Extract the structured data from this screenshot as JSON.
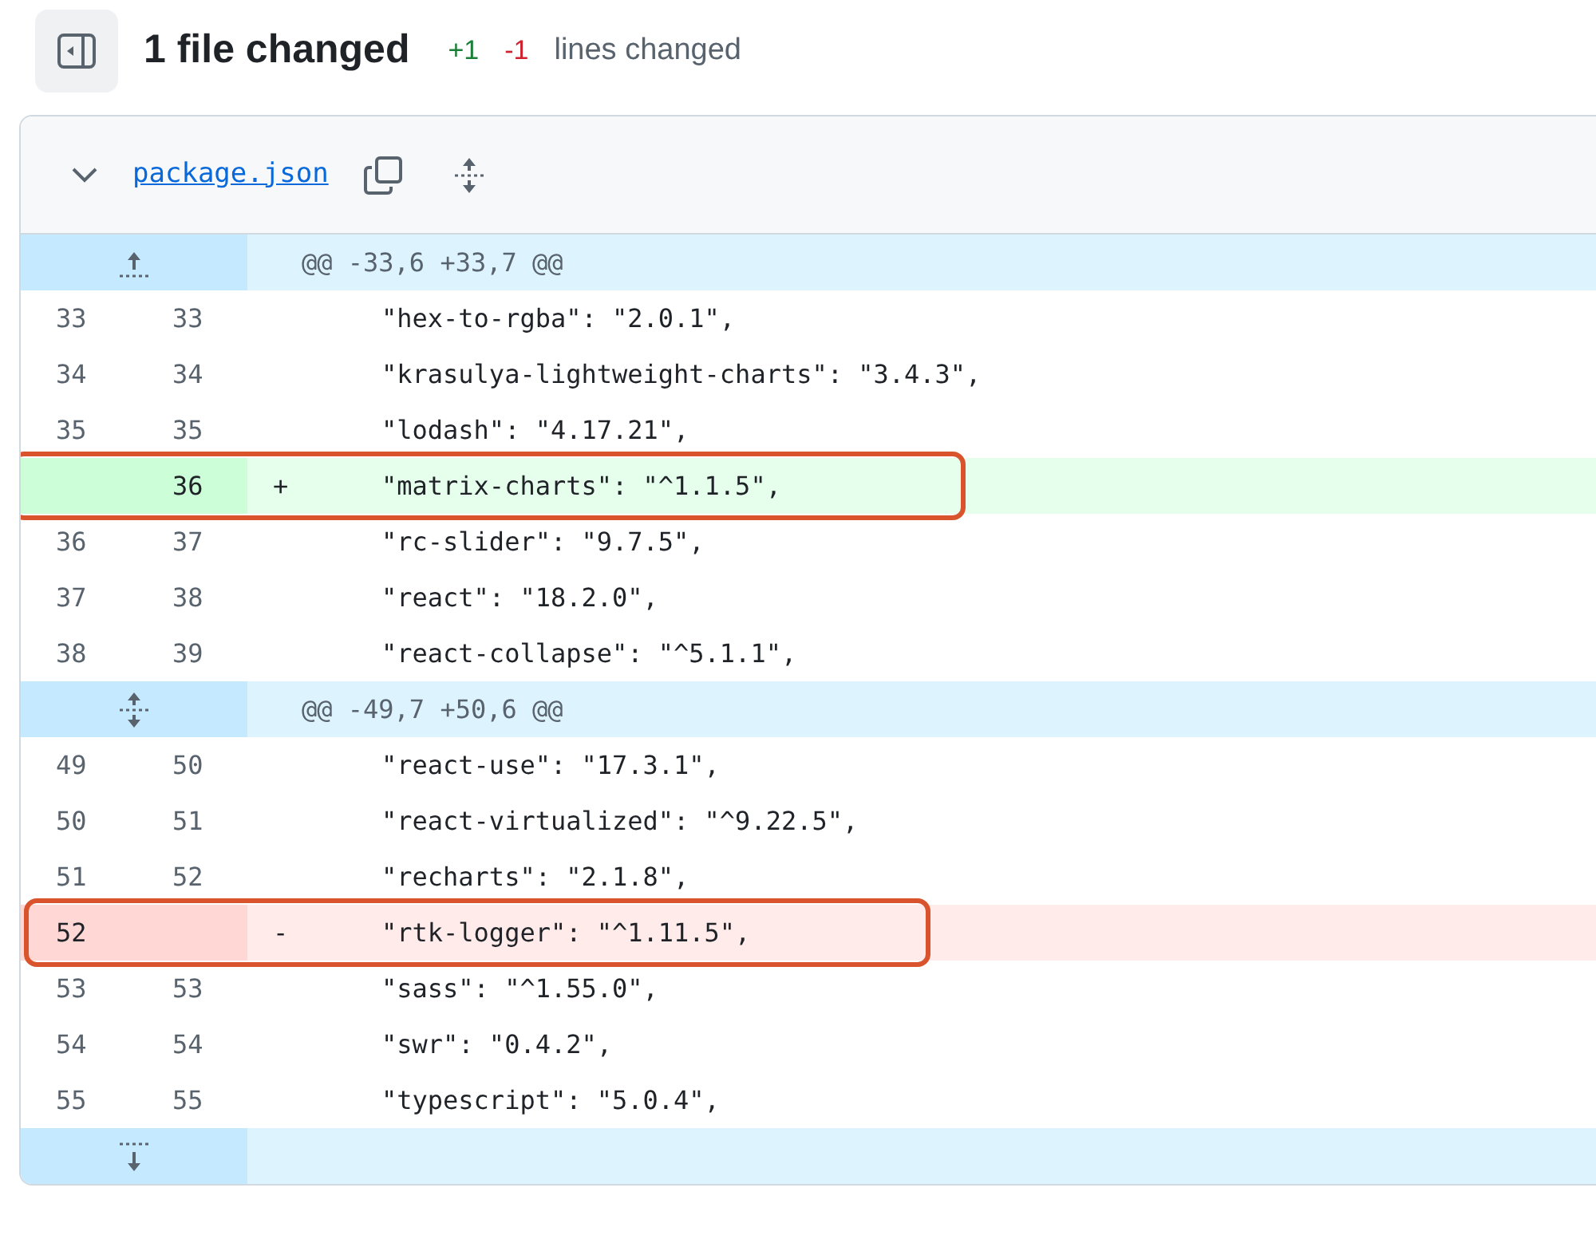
{
  "header": {
    "title": "1 file changed",
    "additions": "+1",
    "deletions": "-1",
    "summary": "lines changed"
  },
  "file": {
    "name": "package.json",
    "expanded": true
  },
  "diff": [
    {
      "kind": "hunk_up",
      "text": "@@ -33,6 +33,7 @@"
    },
    {
      "kind": "context",
      "old": "33",
      "new": "33",
      "code": "\"hex-to-rgba\": \"2.0.1\","
    },
    {
      "kind": "context",
      "old": "34",
      "new": "34",
      "code": "\"krasulya-lightweight-charts\": \"3.4.3\","
    },
    {
      "kind": "context",
      "old": "35",
      "new": "35",
      "code": "\"lodash\": \"4.17.21\","
    },
    {
      "kind": "add",
      "new": "36",
      "sign": "+",
      "code": "\"matrix-charts\": \"^1.1.5\",",
      "highlighted": true
    },
    {
      "kind": "context",
      "old": "36",
      "new": "37",
      "code": "\"rc-slider\": \"9.7.5\","
    },
    {
      "kind": "context",
      "old": "37",
      "new": "38",
      "code": "\"react\": \"18.2.0\","
    },
    {
      "kind": "context",
      "old": "38",
      "new": "39",
      "code": "\"react-collapse\": \"^5.1.1\","
    },
    {
      "kind": "hunk_both",
      "text": "@@ -49,7 +50,6 @@"
    },
    {
      "kind": "context",
      "old": "49",
      "new": "50",
      "code": "\"react-use\": \"17.3.1\","
    },
    {
      "kind": "context",
      "old": "50",
      "new": "51",
      "code": "\"react-virtualized\": \"^9.22.5\","
    },
    {
      "kind": "context",
      "old": "51",
      "new": "52",
      "code": "\"recharts\": \"2.1.8\","
    },
    {
      "kind": "del",
      "old": "52",
      "sign": "-",
      "code": "\"rtk-logger\": \"^1.11.5\",",
      "highlighted": true
    },
    {
      "kind": "context",
      "old": "53",
      "new": "53",
      "code": "\"sass\": \"^1.55.0\","
    },
    {
      "kind": "context",
      "old": "54",
      "new": "54",
      "code": "\"swr\": \"0.4.2\","
    },
    {
      "kind": "context",
      "old": "55",
      "new": "55",
      "code": "\"typescript\": \"5.0.4\","
    },
    {
      "kind": "hunk_down"
    }
  ]
}
